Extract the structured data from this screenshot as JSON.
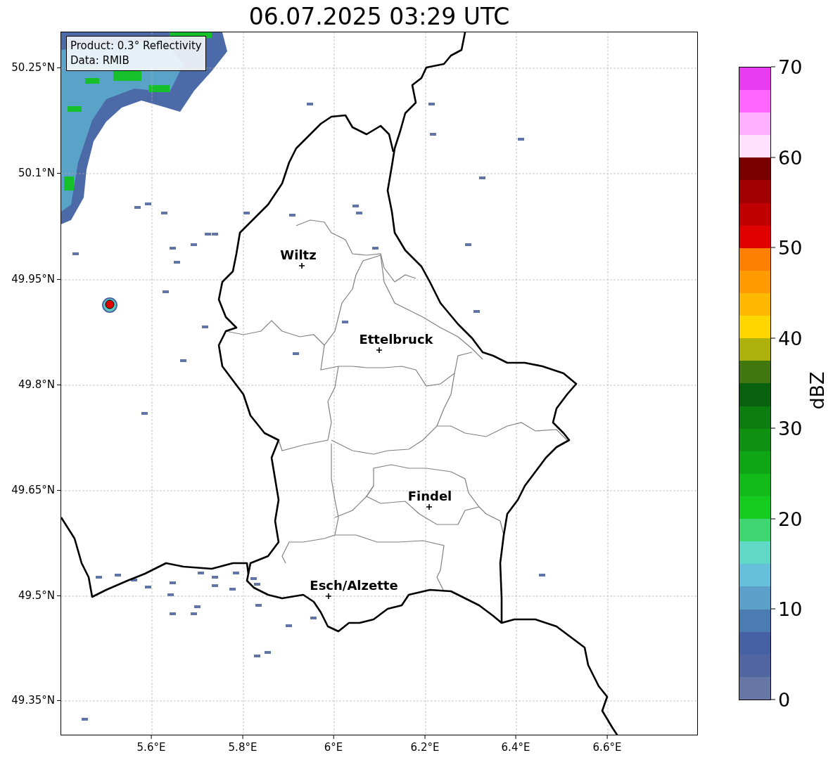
{
  "title": "06.07.2025 03:29 UTC",
  "info_box": {
    "lines": [
      "Product: 0.3° Reflectivity",
      "Data: RMIB"
    ]
  },
  "map": {
    "x_ticks": [
      "5.6°E",
      "5.8°E",
      "6°E",
      "6.2°E",
      "6.4°E",
      "6.6°E"
    ],
    "y_ticks": [
      "50.25°N",
      "50.1°N",
      "49.95°N",
      "49.8°N",
      "49.65°N",
      "49.5°N",
      "49.35°N"
    ],
    "places": [
      {
        "name": "Wiltz"
      },
      {
        "name": "Ettelbruck"
      },
      {
        "name": "Findel"
      },
      {
        "name": "Esch/Alzette"
      }
    ]
  },
  "colorbar": {
    "label": "dBZ",
    "ticks": [
      "70",
      "60",
      "50",
      "40",
      "30",
      "20",
      "10",
      "0"
    ],
    "segments": [
      {
        "color": "#6677a6"
      },
      {
        "color": "#5166a0"
      },
      {
        "color": "#4560a3"
      },
      {
        "color": "#4a7bb1"
      },
      {
        "color": "#5aa0c8"
      },
      {
        "color": "#66c0dc"
      },
      {
        "color": "#60d8c8"
      },
      {
        "color": "#3dd670"
      },
      {
        "color": "#15cb1e"
      },
      {
        "color": "#12bb18"
      },
      {
        "color": "#10a514"
      },
      {
        "color": "#0f9212"
      },
      {
        "color": "#0d7d10"
      },
      {
        "color": "#08610d"
      },
      {
        "color": "#42760f"
      },
      {
        "color": "#adb10a"
      },
      {
        "color": "#ffd600"
      },
      {
        "color": "#ffb800"
      },
      {
        "color": "#ff9a00"
      },
      {
        "color": "#ff7f00"
      },
      {
        "color": "#e00000"
      },
      {
        "color": "#c00000"
      },
      {
        "color": "#a00000"
      },
      {
        "color": "#7a0000"
      },
      {
        "color": "#ffe0ff"
      },
      {
        "color": "#ffb0ff"
      },
      {
        "color": "#ff66ff"
      },
      {
        "color": "#e83aee"
      }
    ]
  }
}
